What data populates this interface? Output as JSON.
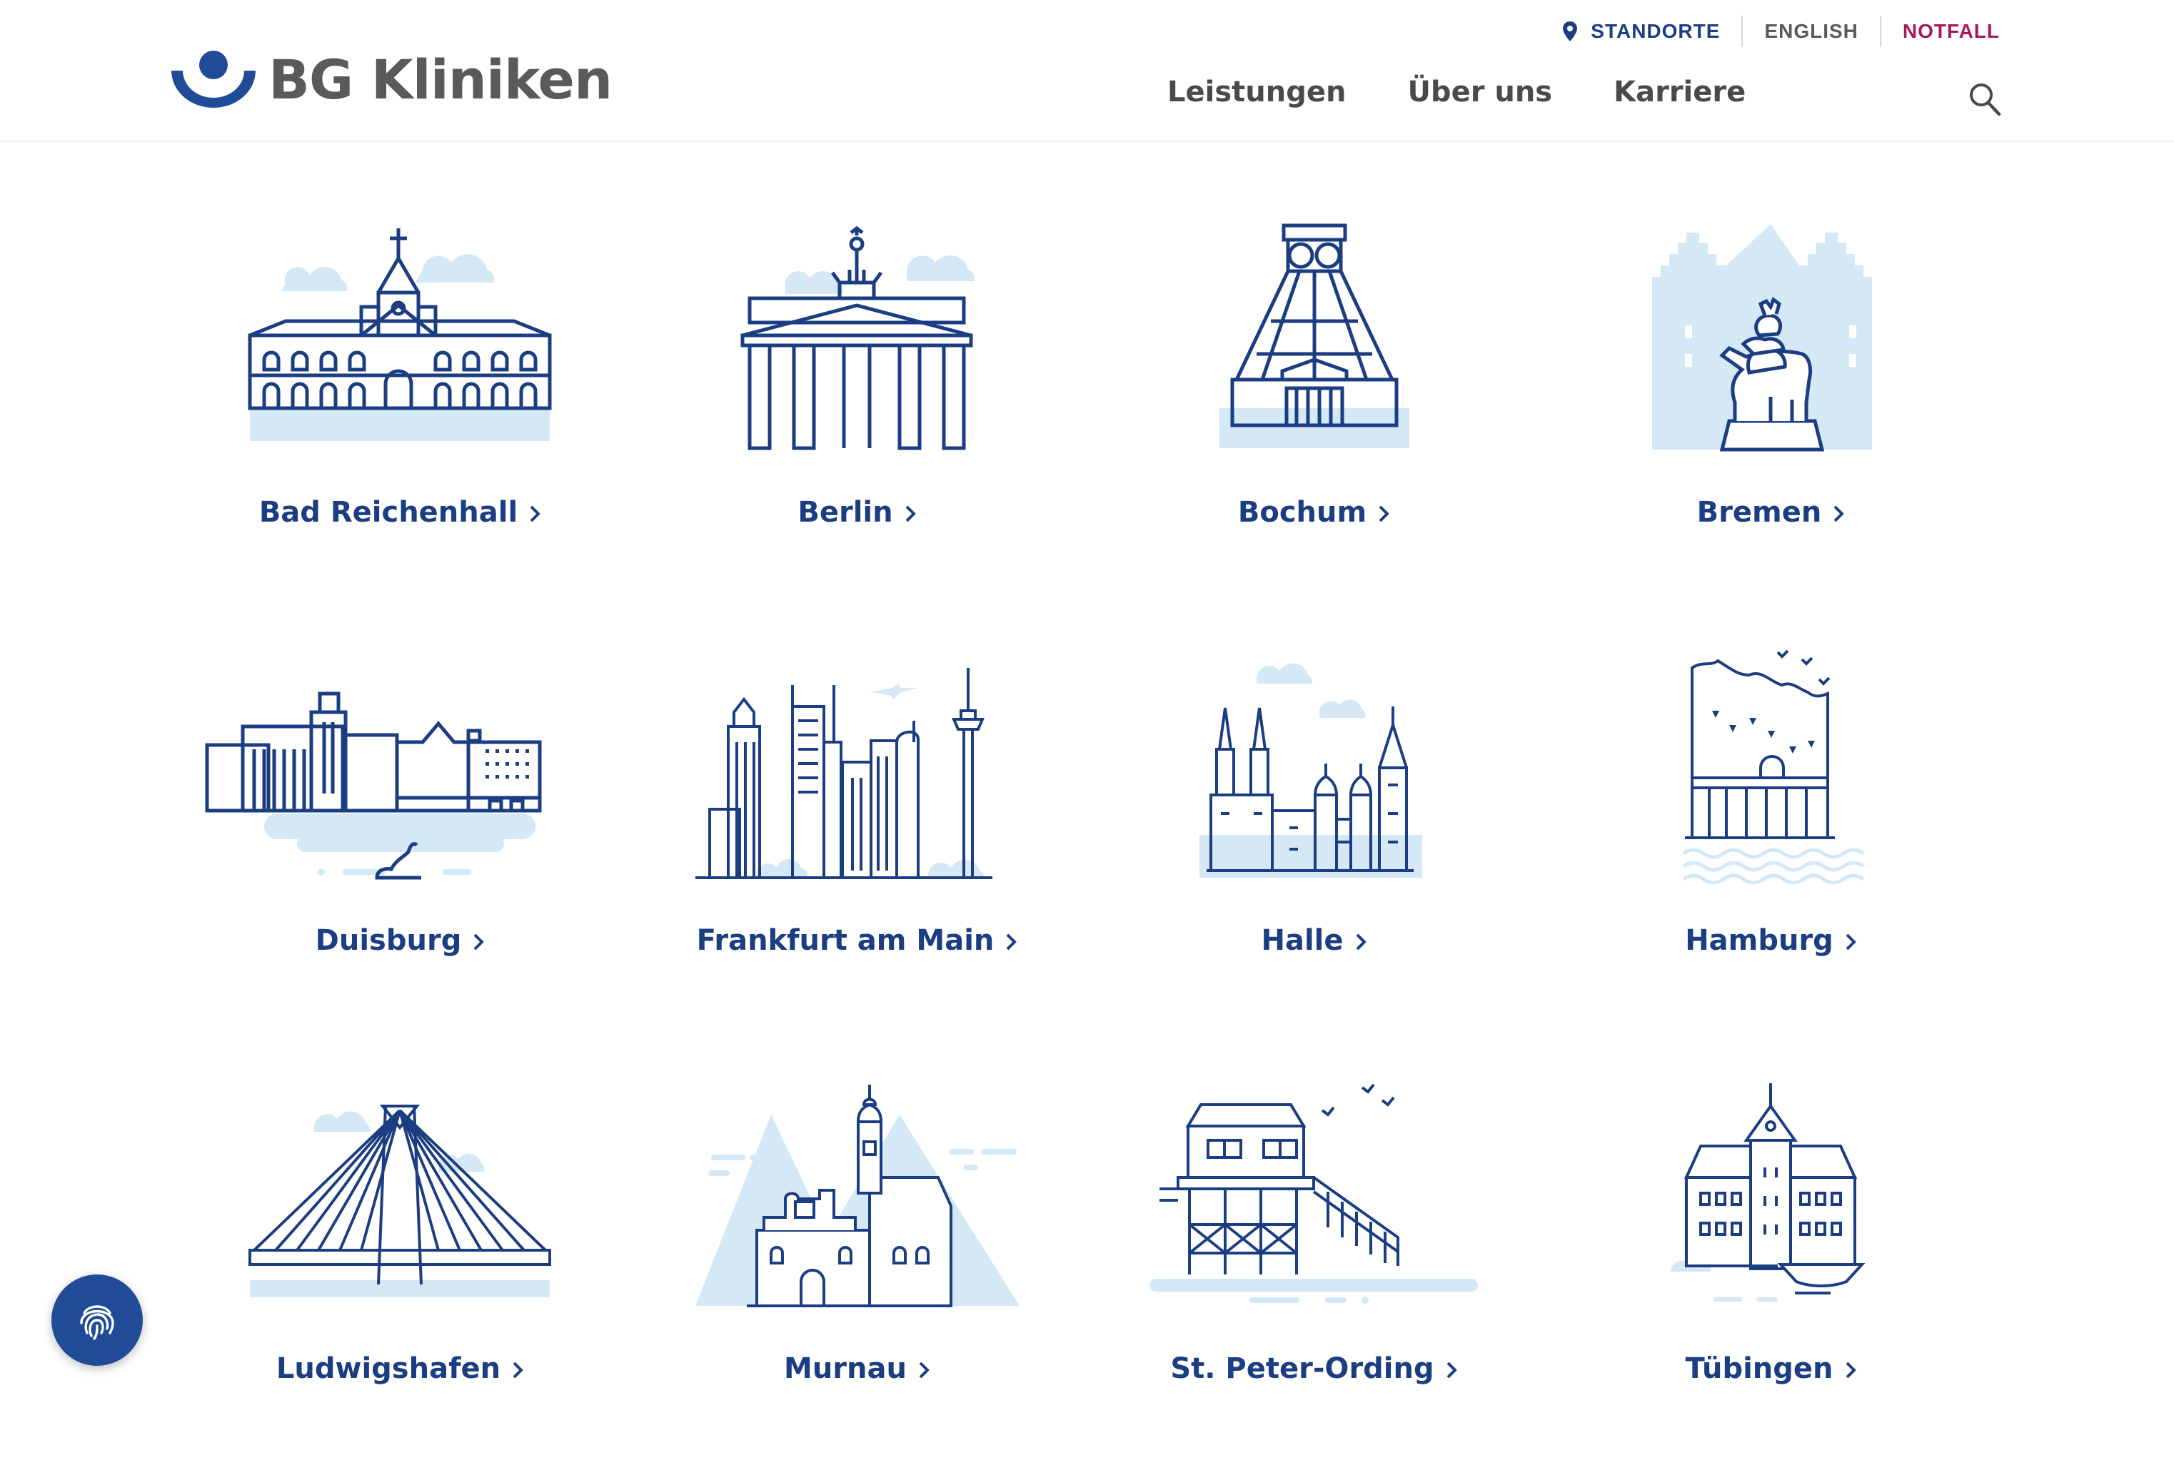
{
  "brand": {
    "name": "BG Kliniken"
  },
  "topbar": {
    "standorte": "STANDORTE",
    "english": "ENGLISH",
    "notfall": "NOTFALL"
  },
  "nav": {
    "items": [
      "Leistungen",
      "Über uns",
      "Karriere"
    ]
  },
  "icons": {
    "search": "search-icon",
    "pin": "location-pin-icon",
    "chevron": "chevron-right-icon",
    "fab": "fingerprint-icon"
  },
  "colors": {
    "primary": "#1b3d82",
    "accent_light": "#d4e8f6",
    "notfall": "#a8195b",
    "nav_text": "#4a4a4a"
  },
  "locations": [
    {
      "name": "Bad Reichenhall"
    },
    {
      "name": "Berlin"
    },
    {
      "name": "Bochum"
    },
    {
      "name": "Bremen"
    },
    {
      "name": "Duisburg"
    },
    {
      "name": "Frankfurt am Main"
    },
    {
      "name": "Halle"
    },
    {
      "name": "Hamburg"
    },
    {
      "name": "Ludwigshafen"
    },
    {
      "name": "Murnau"
    },
    {
      "name": "St. Peter-Ording"
    },
    {
      "name": "Tübingen"
    }
  ]
}
